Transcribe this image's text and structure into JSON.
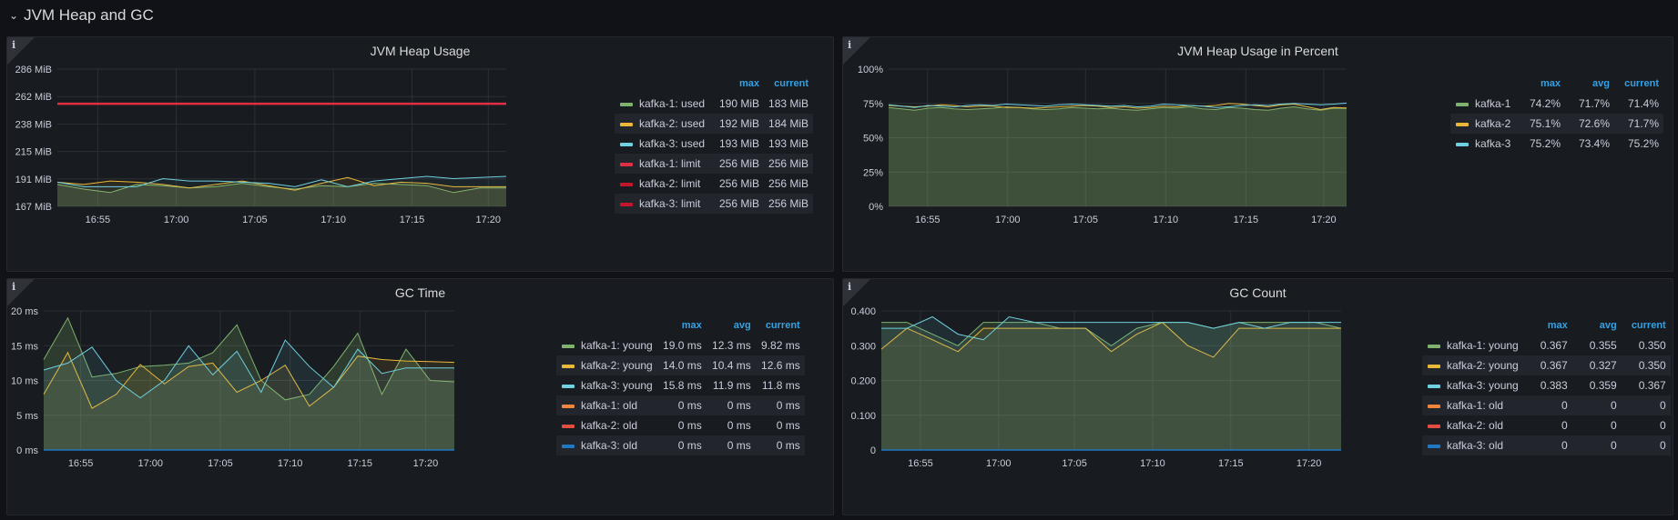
{
  "row": {
    "title": "JVM Heap and GC",
    "chevron": "⌄"
  },
  "panels": {
    "heap": {
      "title": "JVM Heap Usage",
      "info": "i",
      "yticks": [
        "286 MiB",
        "262 MiB",
        "238 MiB",
        "215 MiB",
        "191 MiB",
        "167 MiB"
      ],
      "xticks": [
        "16:55",
        "17:00",
        "17:05",
        "17:10",
        "17:15",
        "17:20"
      ],
      "legend_headers": [
        "max",
        "current"
      ],
      "legend": [
        {
          "name": "kafka-1: used",
          "color": "#7eb26d",
          "values": [
            "190 MiB",
            "183 MiB"
          ]
        },
        {
          "name": "kafka-2: used",
          "color": "#eab839",
          "values": [
            "192 MiB",
            "184 MiB"
          ]
        },
        {
          "name": "kafka-3: used",
          "color": "#6ed0e0",
          "values": [
            "193 MiB",
            "193 MiB"
          ]
        },
        {
          "name": "kafka-1: limit",
          "color": "#e02f44",
          "values": [
            "256 MiB",
            "256 MiB"
          ]
        },
        {
          "name": "kafka-2: limit",
          "color": "#c4162a",
          "values": [
            "256 MiB",
            "256 MiB"
          ]
        },
        {
          "name": "kafka-3: limit",
          "color": "#c4162a",
          "values": [
            "256 MiB",
            "256 MiB"
          ]
        }
      ]
    },
    "heap_pct": {
      "title": "JVM Heap Usage in Percent",
      "info": "i",
      "yticks": [
        "100%",
        "75%",
        "50%",
        "25%",
        "0%"
      ],
      "xticks": [
        "16:55",
        "17:00",
        "17:05",
        "17:10",
        "17:15",
        "17:20"
      ],
      "legend_headers": [
        "max",
        "avg",
        "current"
      ],
      "legend": [
        {
          "name": "kafka-1",
          "color": "#7eb26d",
          "values": [
            "74.2%",
            "71.7%",
            "71.4%"
          ]
        },
        {
          "name": "kafka-2",
          "color": "#eab839",
          "values": [
            "75.1%",
            "72.6%",
            "71.7%"
          ]
        },
        {
          "name": "kafka-3",
          "color": "#6ed0e0",
          "values": [
            "75.2%",
            "73.4%",
            "75.2%"
          ]
        }
      ]
    },
    "gc_time": {
      "title": "GC Time",
      "info": "i",
      "yticks": [
        "20 ms",
        "15 ms",
        "10 ms",
        "5 ms",
        "0 ms"
      ],
      "xticks": [
        "16:55",
        "17:00",
        "17:05",
        "17:10",
        "17:15",
        "17:20"
      ],
      "legend_headers": [
        "max",
        "avg",
        "current"
      ],
      "legend": [
        {
          "name": "kafka-1: young",
          "color": "#7eb26d",
          "values": [
            "19.0 ms",
            "12.3 ms",
            "9.82 ms"
          ]
        },
        {
          "name": "kafka-2: young",
          "color": "#eab839",
          "values": [
            "14.0 ms",
            "10.4 ms",
            "12.6 ms"
          ]
        },
        {
          "name": "kafka-3: young",
          "color": "#6ed0e0",
          "values": [
            "15.8 ms",
            "11.9 ms",
            "11.8 ms"
          ]
        },
        {
          "name": "kafka-1: old",
          "color": "#ef843c",
          "values": [
            "0 ms",
            "0 ms",
            "0 ms"
          ]
        },
        {
          "name": "kafka-2: old",
          "color": "#e24d42",
          "values": [
            "0 ms",
            "0 ms",
            "0 ms"
          ]
        },
        {
          "name": "kafka-3: old",
          "color": "#1f78c1",
          "values": [
            "0 ms",
            "0 ms",
            "0 ms"
          ]
        }
      ]
    },
    "gc_count": {
      "title": "GC Count",
      "info": "i",
      "yticks": [
        "0.400",
        "0.300",
        "0.200",
        "0.100",
        "0"
      ],
      "xticks": [
        "16:55",
        "17:00",
        "17:05",
        "17:10",
        "17:15",
        "17:20"
      ],
      "legend_headers": [
        "max",
        "avg",
        "current"
      ],
      "legend": [
        {
          "name": "kafka-1: young",
          "color": "#7eb26d",
          "values": [
            "0.367",
            "0.355",
            "0.350"
          ]
        },
        {
          "name": "kafka-2: young",
          "color": "#eab839",
          "values": [
            "0.367",
            "0.327",
            "0.350"
          ]
        },
        {
          "name": "kafka-3: young",
          "color": "#6ed0e0",
          "values": [
            "0.383",
            "0.359",
            "0.367"
          ]
        },
        {
          "name": "kafka-1: old",
          "color": "#ef843c",
          "values": [
            "0",
            "0",
            "0"
          ]
        },
        {
          "name": "kafka-2: old",
          "color": "#e24d42",
          "values": [
            "0",
            "0",
            "0"
          ]
        },
        {
          "name": "kafka-3: old",
          "color": "#1f78c1",
          "values": [
            "0",
            "0",
            "0"
          ]
        }
      ]
    }
  },
  "series": {
    "heap": {
      "ymin": 167,
      "ymax": 286,
      "k1": [
        186,
        182,
        179,
        186,
        185,
        183,
        184,
        187,
        184,
        182,
        185,
        184,
        187,
        186,
        185,
        179,
        183,
        183
      ],
      "k2": [
        188,
        186,
        189,
        188,
        186,
        183,
        186,
        189,
        185,
        181,
        187,
        192,
        185,
        188,
        187,
        184,
        184,
        184
      ],
      "k3": [
        188,
        184,
        184,
        184,
        191,
        189,
        189,
        188,
        187,
        184,
        190,
        184,
        189,
        191,
        193,
        191,
        192,
        193
      ],
      "limit": 256
    },
    "heap_pct": {
      "k1": [
        72.0,
        71.0,
        70.0,
        71.5,
        72.0,
        71.0,
        70.5,
        71.0,
        71.5,
        72.5,
        72.0,
        71.0,
        70.5,
        71.0,
        72.0,
        71.5,
        71.0,
        71.5,
        70.5,
        70.0,
        71.0,
        72.0,
        71.5,
        72.5,
        71.0,
        70.5,
        72.0,
        71.5,
        70.5,
        70.0,
        71.5,
        72.5,
        71.0,
        70.0,
        71.5,
        71.4
      ],
      "k2": [
        73.5,
        73.0,
        72.5,
        73.0,
        74.0,
        73.5,
        72.5,
        73.0,
        73.0,
        72.0,
        72.0,
        71.5,
        72.0,
        72.5,
        73.0,
        73.5,
        73.0,
        72.0,
        72.5,
        71.5,
        72.0,
        73.0,
        72.5,
        73.5,
        73.0,
        73.5,
        75.0,
        74.5,
        73.5,
        72.5,
        74.0,
        74.5,
        72.5,
        70.5,
        72.0,
        71.7
      ],
      "k3": [
        74.0,
        73.0,
        72.0,
        73.5,
        73.0,
        72.5,
        73.5,
        74.0,
        73.5,
        74.5,
        74.0,
        73.5,
        73.0,
        74.0,
        74.5,
        74.0,
        73.5,
        73.0,
        73.5,
        72.5,
        73.0,
        74.5,
        74.0,
        73.5,
        73.0,
        72.0,
        72.5,
        73.5,
        74.0,
        73.5,
        74.5,
        75.0,
        74.5,
        74.0,
        74.5,
        75.2
      ]
    },
    "gc_time": {
      "k1": [
        13.0,
        19.0,
        10.5,
        11.0,
        12.0,
        12.2,
        12.5,
        14.0,
        18.0,
        10.0,
        7.2,
        8.0,
        12.0,
        16.8,
        8.0,
        14.5,
        10.0,
        9.8
      ],
      "k2": [
        8.0,
        14.0,
        6.0,
        8.0,
        12.3,
        9.5,
        12.0,
        12.5,
        8.3,
        10.0,
        12.2,
        6.3,
        9.0,
        13.5,
        13.0,
        12.8,
        12.7,
        12.6
      ],
      "k3": [
        11.5,
        12.5,
        14.8,
        10.0,
        7.5,
        10.0,
        15.0,
        10.8,
        14.2,
        8.3,
        15.8,
        12.0,
        9.0,
        14.5,
        11.0,
        11.8,
        11.8,
        11.8
      ]
    },
    "gc_count": {
      "k1": [
        0.367,
        0.367,
        0.333,
        0.3,
        0.367,
        0.367,
        0.367,
        0.35,
        0.35,
        0.3,
        0.35,
        0.367,
        0.367,
        0.35,
        0.367,
        0.367,
        0.367,
        0.367,
        0.35
      ],
      "k2": [
        0.29,
        0.35,
        0.317,
        0.283,
        0.35,
        0.35,
        0.35,
        0.35,
        0.35,
        0.283,
        0.333,
        0.367,
        0.3,
        0.267,
        0.35,
        0.35,
        0.35,
        0.35,
        0.35
      ],
      "k3": [
        0.35,
        0.35,
        0.383,
        0.333,
        0.317,
        0.383,
        0.367,
        0.367,
        0.367,
        0.367,
        0.367,
        0.367,
        0.367,
        0.35,
        0.367,
        0.35,
        0.367,
        0.367,
        0.367
      ]
    }
  }
}
